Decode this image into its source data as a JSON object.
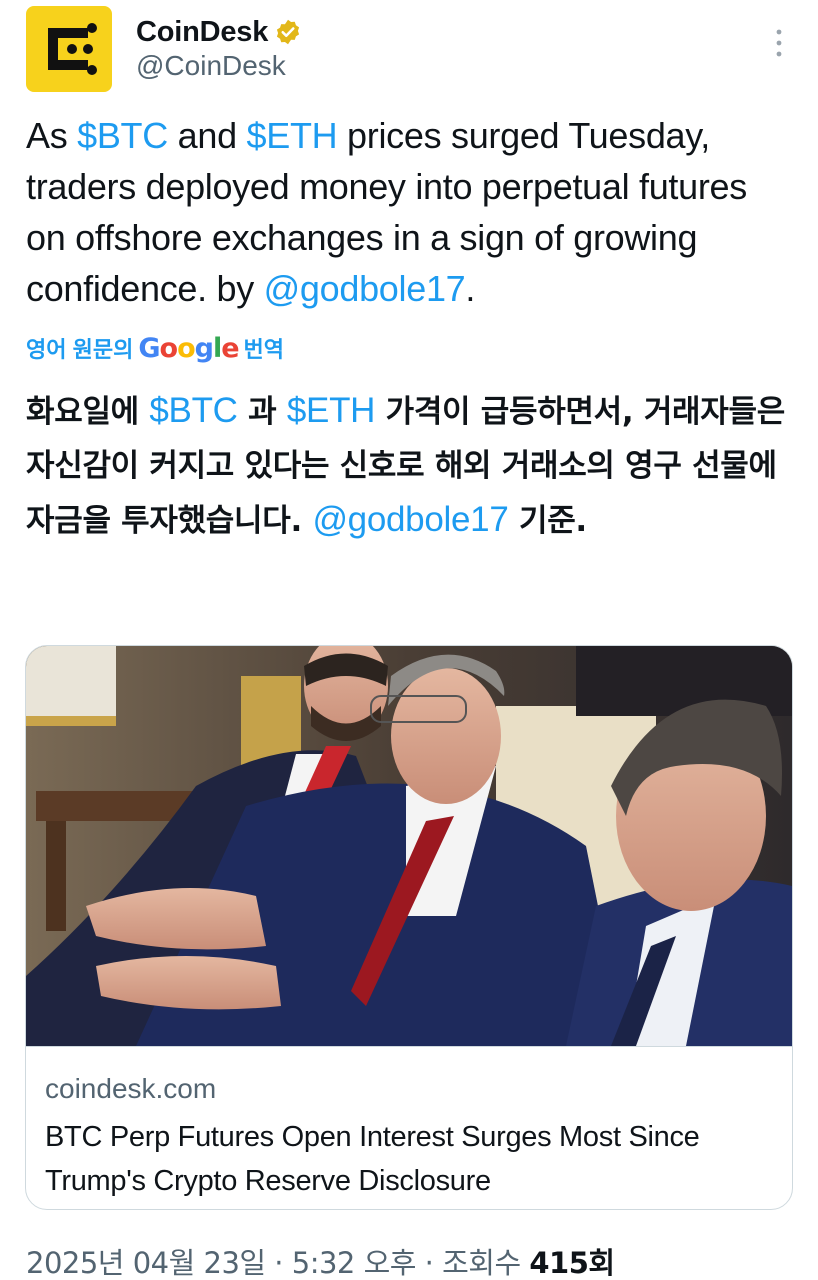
{
  "author": {
    "display_name": "CoinDesk",
    "handle": "@CoinDesk",
    "verified_badge_color": "#e2b719",
    "avatar_color": "#f7d21c",
    "avatar_icon": "coindesk-logo-icon"
  },
  "tweet": {
    "segments": [
      {
        "text": "As ",
        "type": "text"
      },
      {
        "text": "$BTC",
        "type": "link"
      },
      {
        "text": " and ",
        "type": "text"
      },
      {
        "text": "$ETH",
        "type": "link"
      },
      {
        "text": " prices surged Tuesday, traders deployed money into perpetual futures on offshore exchanges in a sign of growing confidence. by ",
        "type": "text"
      },
      {
        "text": "@godbole17",
        "type": "link"
      },
      {
        "text": ".",
        "type": "text"
      }
    ]
  },
  "translate": {
    "prefix": "영어 원문의",
    "suffix": "번역",
    "google_letters": [
      "G",
      "o",
      "o",
      "g",
      "l",
      "e"
    ]
  },
  "translated": {
    "segments": [
      {
        "text": "화요일에 ",
        "type": "text"
      },
      {
        "text": "$BTC",
        "type": "link"
      },
      {
        "text": " 과 ",
        "type": "text"
      },
      {
        "text": "$ETH",
        "type": "link"
      },
      {
        "text": " 가격이 급등하면서, 거래자들은 자신감이 커지고 있다는 신호로 해외 거래소의 영구 선물에 자금을 투자했습니다. ",
        "type": "text"
      },
      {
        "text": "@godbole17",
        "type": "link"
      },
      {
        "text": " 기준.",
        "type": "text"
      }
    ]
  },
  "card": {
    "domain": "coindesk.com",
    "title": "BTC Perp Futures Open Interest Surges Most Since Trump's Crypto Reserve Disclosure"
  },
  "footer": {
    "date": "2025년 04월 23일",
    "separator": " · ",
    "time": "5:32 오후",
    "views_label": "조회수",
    "views_count": "415회"
  },
  "colors": {
    "link": "#1d9bf0",
    "muted": "#536471",
    "text": "#0f1419"
  }
}
